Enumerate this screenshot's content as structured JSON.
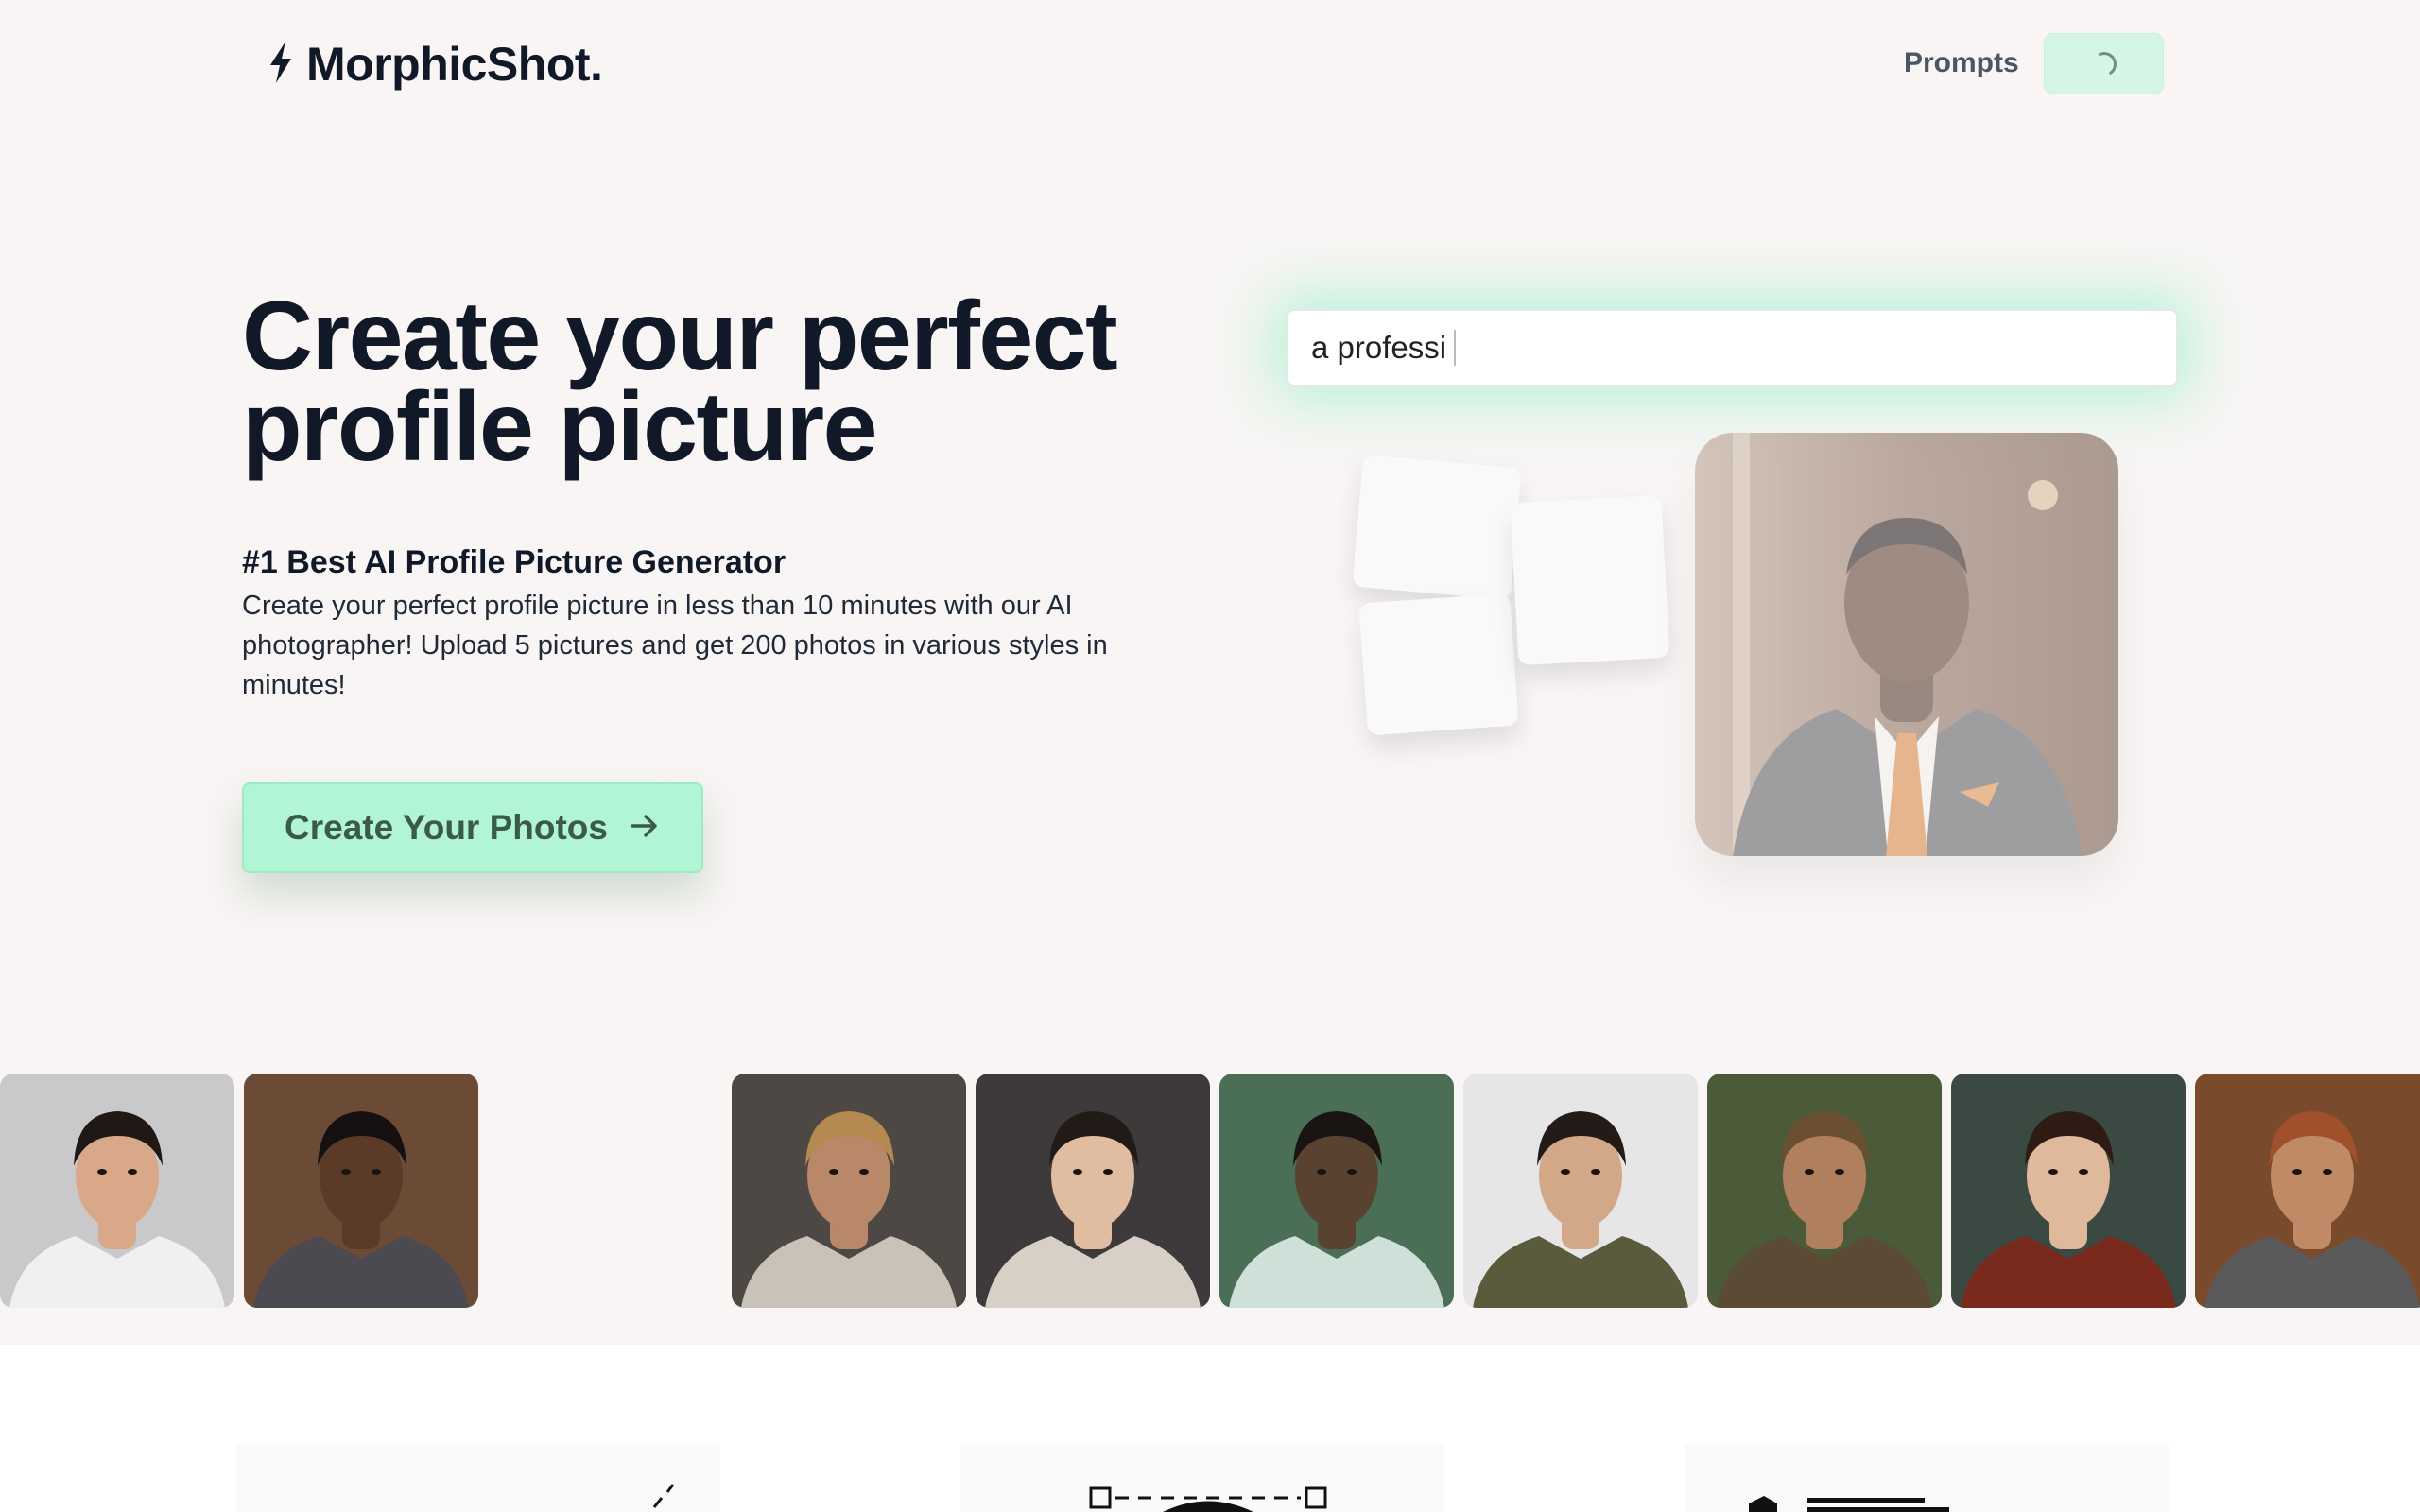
{
  "brand": {
    "name": "MorphicShot.",
    "logo_icon": "lightning-bolt-icon"
  },
  "nav": {
    "prompts_label": "Prompts",
    "loading_button_icon": "spinner-icon"
  },
  "hero": {
    "title": "Create your perfect profile picture",
    "subtitle": "#1 Best AI Profile Picture Generator",
    "description": "Create your perfect profile picture in less than 10 minutes with our AI photographer! Upload 5 pictures and get 200 photos in various styles in minutes!",
    "cta_label": "Create Your Photos",
    "cta_icon": "arrow-right-icon"
  },
  "demo": {
    "prompt_text": "a professi",
    "portrait_icon": "businessman-portrait-icon"
  },
  "gallery": {
    "items": [
      {
        "name": "portrait-woman-professional",
        "bg": "#c9c9cc",
        "skin": "#d8a888",
        "hair": "#1f1815",
        "cloth": "#f0f0f2"
      },
      {
        "name": "portrait-man-suit",
        "bg": "#6b4a36",
        "skin": "#5b3a28",
        "hair": "#161110",
        "cloth": "#4a4a50"
      },
      {
        "name": "portrait-warrior-armor",
        "bg": "#4e4844",
        "skin": "#b88868",
        "hair": "#b48a50",
        "cloth": "#c9c2b8"
      },
      {
        "name": "portrait-woman-fantasy",
        "bg": "#3e3a3c",
        "skin": "#e0bda0",
        "hair": "#221a16",
        "cloth": "#d8d0c6"
      },
      {
        "name": "portrait-man-astronaut",
        "bg": "#4a6e56",
        "skin": "#5a4230",
        "hair": "#1a1512",
        "cloth": "#cfe0d8"
      },
      {
        "name": "portrait-woman-olive",
        "bg": "#e6e6e6",
        "skin": "#d2a888",
        "hair": "#231b18",
        "cloth": "#5a5a3c"
      },
      {
        "name": "portrait-man-rugged",
        "bg": "#4b5a38",
        "skin": "#b0805e",
        "hair": "#6a5030",
        "cloth": "#5a4a36"
      },
      {
        "name": "portrait-woman-glasses",
        "bg": "#3a4a42",
        "skin": "#e0b89c",
        "hair": "#2e1c14",
        "cloth": "#7a2a1c"
      },
      {
        "name": "portrait-man-curly",
        "bg": "#7a4a2c",
        "skin": "#c08a66",
        "hair": "#a0502a",
        "cloth": "#5a5a5a"
      }
    ]
  },
  "colors": {
    "page_bg": "#f8f5f4",
    "accent": "#b2f5d4",
    "accent_glow": "#82f0be",
    "text_primary": "#111827"
  }
}
